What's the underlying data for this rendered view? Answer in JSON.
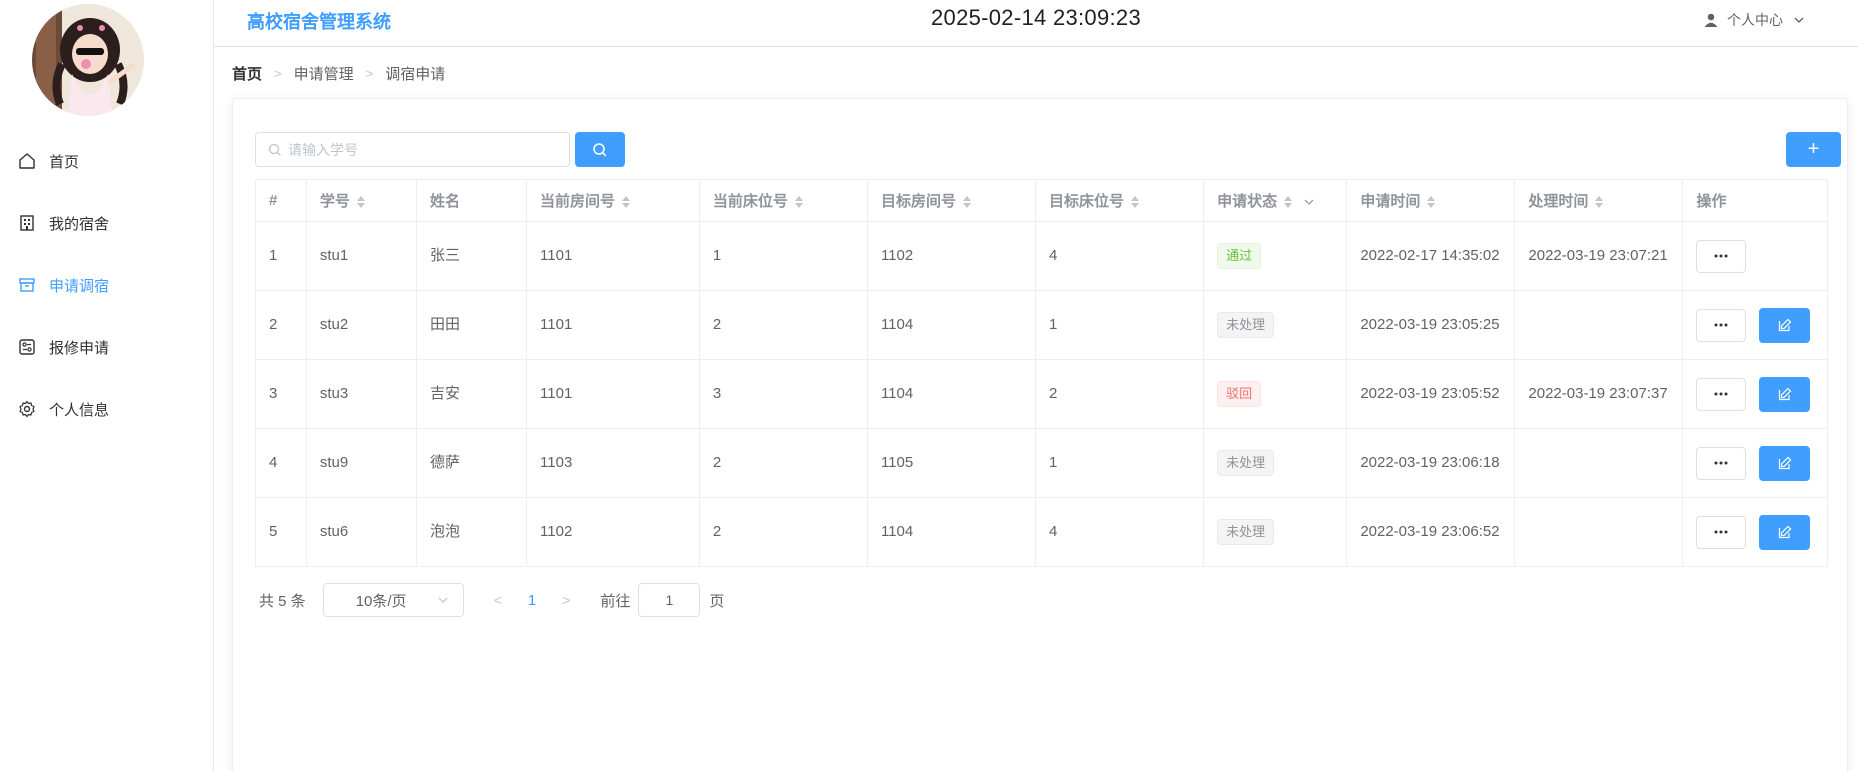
{
  "header": {
    "title": "高校宿舍管理系统",
    "clock": "2025-02-14 23:09:23",
    "user_label": "个人中心"
  },
  "sidebar": {
    "items": [
      {
        "label": "首页",
        "icon": "home-icon",
        "active": false
      },
      {
        "label": "我的宿舍",
        "icon": "building-icon",
        "active": false
      },
      {
        "label": "申请调宿",
        "icon": "box-icon",
        "active": true
      },
      {
        "label": "报修申请",
        "icon": "repair-icon",
        "active": false
      },
      {
        "label": "个人信息",
        "icon": "gear-icon",
        "active": false
      }
    ]
  },
  "breadcrumb": [
    "首页",
    "申请管理",
    "调宿申请"
  ],
  "search": {
    "placeholder": "请输入学号"
  },
  "add_button": "+",
  "table": {
    "columns": [
      "#",
      "学号",
      "姓名",
      "当前房间号",
      "当前床位号",
      "目标房间号",
      "目标床位号",
      "申请状态",
      "申请时间",
      "处理时间",
      "操作"
    ],
    "rows": [
      {
        "idx": "1",
        "student_id": "stu1",
        "name": "张三",
        "cur_room": "1101",
        "cur_bed": "1",
        "target_room": "1102",
        "target_bed": "4",
        "status": "通过",
        "status_type": "success",
        "apply_time": "2022-02-17 14:35:02",
        "handle_time": "2022-03-19 23:07:21",
        "editable": false
      },
      {
        "idx": "2",
        "student_id": "stu2",
        "name": "田田",
        "cur_room": "1101",
        "cur_bed": "2",
        "target_room": "1104",
        "target_bed": "1",
        "status": "未处理",
        "status_type": "info",
        "apply_time": "2022-03-19 23:05:25",
        "handle_time": "",
        "editable": true
      },
      {
        "idx": "3",
        "student_id": "stu3",
        "name": "吉安",
        "cur_room": "1101",
        "cur_bed": "3",
        "target_room": "1104",
        "target_bed": "2",
        "status": "驳回",
        "status_type": "danger",
        "apply_time": "2022-03-19 23:05:52",
        "handle_time": "2022-03-19 23:07:37",
        "editable": true
      },
      {
        "idx": "4",
        "student_id": "stu9",
        "name": "德萨",
        "cur_room": "1103",
        "cur_bed": "2",
        "target_room": "1105",
        "target_bed": "1",
        "status": "未处理",
        "status_type": "info",
        "apply_time": "2022-03-19 23:06:18",
        "handle_time": "",
        "editable": true
      },
      {
        "idx": "5",
        "student_id": "stu6",
        "name": "泡泡",
        "cur_room": "1102",
        "cur_bed": "2",
        "target_room": "1104",
        "target_bed": "4",
        "status": "未处理",
        "status_type": "info",
        "apply_time": "2022-03-19 23:06:52",
        "handle_time": "",
        "editable": true
      }
    ]
  },
  "pagination": {
    "total_text": "共 5 条",
    "page_size": "10条/页",
    "current_page": "1",
    "goto_label": "前往",
    "goto_value": "1",
    "goto_suffix": "页"
  },
  "colors": {
    "primary": "#409eff",
    "success": "#67c23a",
    "danger": "#f56c6c",
    "info": "#909399"
  }
}
